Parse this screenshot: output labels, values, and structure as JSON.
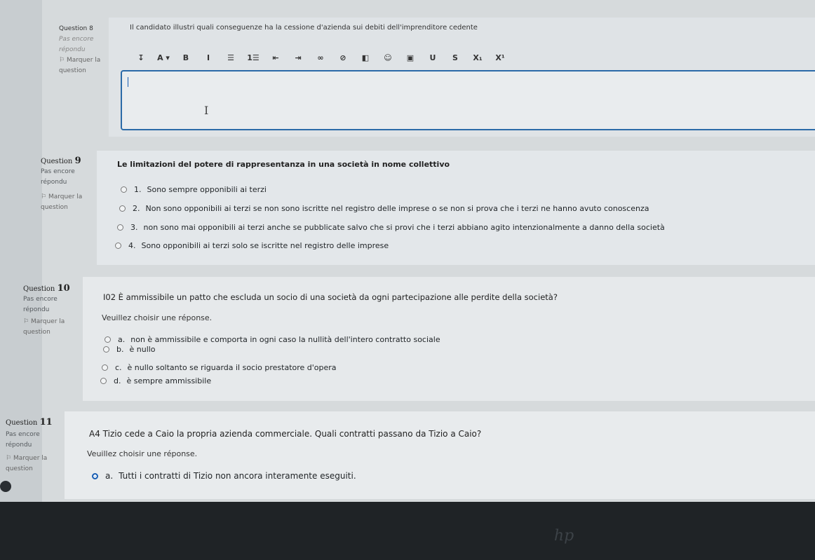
{
  "q8": {
    "number_label": "Question 8",
    "status": "Pas encore répondu",
    "flag": "Marquer la question",
    "text": "Il candidato illustri quali conseguenze ha la cessione d'azienda sui debiti dell'imprenditore cedente",
    "toolbar": [
      "↧",
      "A ▾",
      "B",
      "I",
      "☰",
      "1☰",
      "⇤",
      "⇥",
      "∞",
      "⊘",
      "◧",
      "☺",
      "▣",
      "U",
      "S",
      "X₁",
      "X¹"
    ]
  },
  "q9": {
    "label": "Question",
    "number": "9",
    "status": "Pas encore répondu",
    "flag": "Marquer la question",
    "text": "Le limitazioni del potere di rappresentanza in una società in nome collettivo",
    "options": [
      {
        "num": "1.",
        "text": "Sono sempre opponibili ai terzi"
      },
      {
        "num": "2.",
        "text": "Non sono opponibili ai terzi se non sono iscritte nel registro delle imprese o se non si prova che i terzi ne hanno avuto conoscenza"
      },
      {
        "num": "3.",
        "text": "non sono mai opponibili ai terzi anche se pubblicate salvo che si provi che i terzi abbiano agito intenzionalmente a danno della società"
      },
      {
        "num": "4.",
        "text": "Sono opponibili ai terzi solo se iscritte nel registro delle imprese"
      }
    ]
  },
  "q10": {
    "label": "Question",
    "number": "10",
    "status": "Pas encore répondu",
    "flag": "Marquer la question",
    "text": "I02 È ammissibile un patto che escluda un socio di una società da ogni partecipazione alle perdite della società?",
    "prompt": "Veuillez choisir une réponse.",
    "options": [
      {
        "num": "a.",
        "text": "non è ammissibile e comporta in ogni caso la nullità dell'intero contratto sociale"
      },
      {
        "num": "b.",
        "text": "è nullo"
      },
      {
        "num": "c.",
        "text": "è nullo soltanto se riguarda il socio prestatore d'opera"
      },
      {
        "num": "d.",
        "text": "è sempre ammissibile"
      }
    ]
  },
  "q11": {
    "label": "Question",
    "number": "11",
    "status": "Pas encore répondu",
    "flag": "Marquer la question",
    "text": "A4 Tizio cede a Caio la propria azienda commerciale. Quali contratti passano da Tizio a Caio?",
    "prompt": "Veuillez choisir une réponse.",
    "options": [
      {
        "num": "a.",
        "text": "Tutti i contratti di Tizio non ancora interamente eseguiti.",
        "selected": true
      }
    ]
  }
}
